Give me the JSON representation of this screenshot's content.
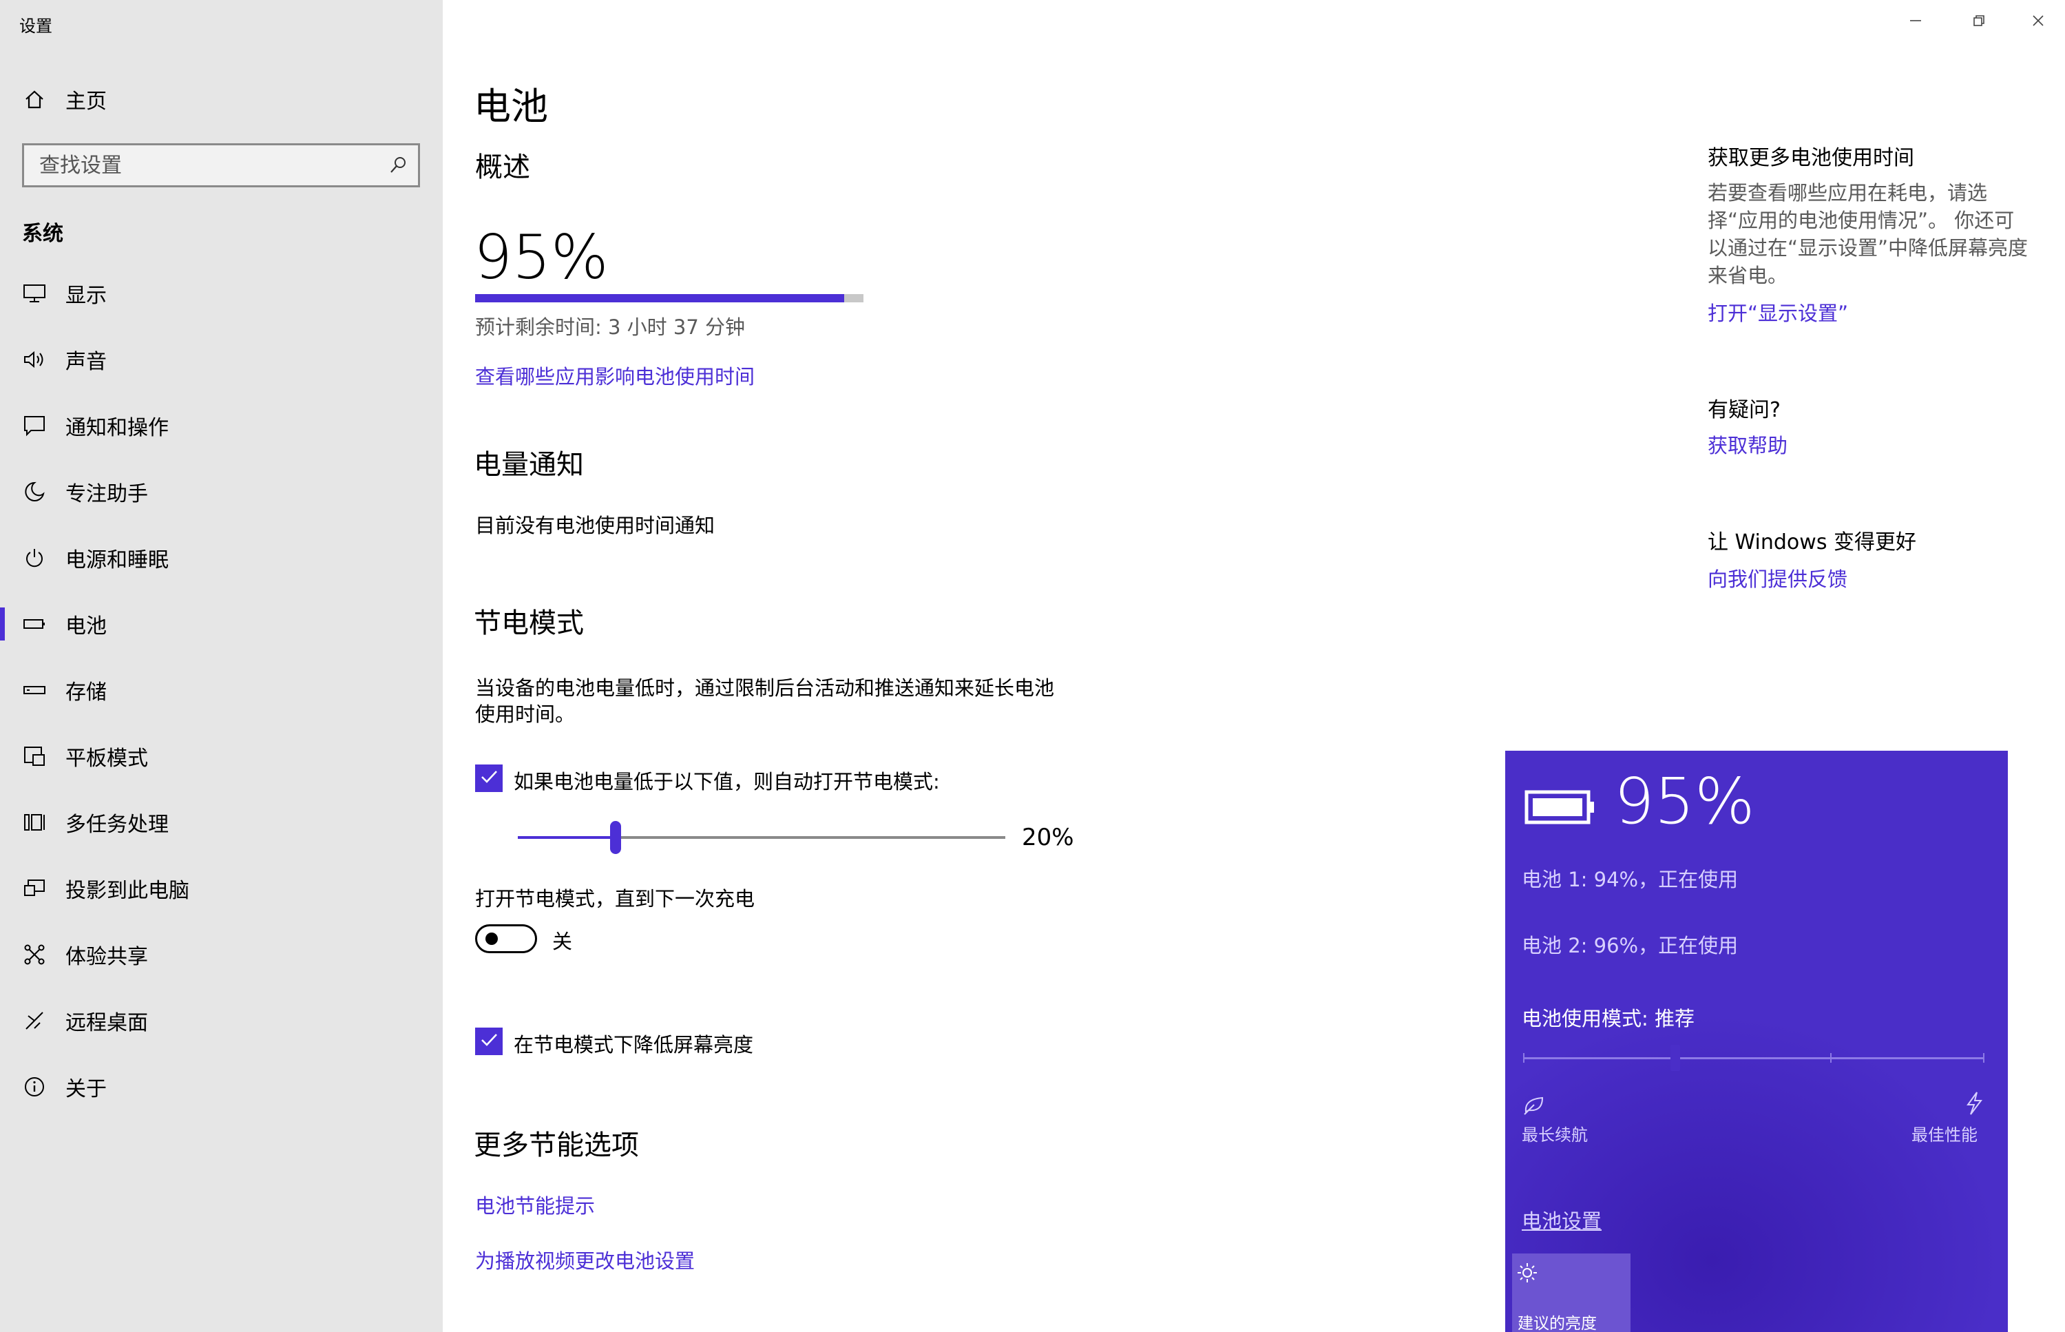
{
  "window": {
    "title": "设置",
    "controls": {
      "minimize": "minimize-icon",
      "restore": "restore-icon",
      "close": "close-icon"
    }
  },
  "sidebar": {
    "home_label": "主页",
    "search_placeholder": "查找设置",
    "section_title": "系统",
    "items": [
      {
        "label": "显示",
        "icon": "monitor-icon"
      },
      {
        "label": "声音",
        "icon": "speaker-icon"
      },
      {
        "label": "通知和操作",
        "icon": "notification-icon"
      },
      {
        "label": "专注助手",
        "icon": "moon-icon"
      },
      {
        "label": "电源和睡眠",
        "icon": "power-icon"
      },
      {
        "label": "电池",
        "icon": "battery-icon",
        "active": true
      },
      {
        "label": "存储",
        "icon": "storage-icon"
      },
      {
        "label": "平板模式",
        "icon": "tablet-icon"
      },
      {
        "label": "多任务处理",
        "icon": "multitask-icon"
      },
      {
        "label": "投影到此电脑",
        "icon": "project-icon"
      },
      {
        "label": "体验共享",
        "icon": "share-icon"
      },
      {
        "label": "远程桌面",
        "icon": "remote-icon"
      },
      {
        "label": "关于",
        "icon": "info-icon"
      }
    ],
    "accent": "#4c2fd6"
  },
  "main": {
    "page_title": "电池",
    "overview": {
      "heading": "概述",
      "percent_text": "95%",
      "percent_value": 0.95,
      "remaining": "预计剩余时间: 3 小时 37 分钟",
      "link": "查看哪些应用影响电池使用时间"
    },
    "notification": {
      "heading": "电量通知",
      "text": "目前没有电池使用时间通知"
    },
    "saver": {
      "heading": "节电模式",
      "description_line1": "当设备的电池电量低时，通过限制后台活动和推送通知来延长电池",
      "description_line2": "使用时间。",
      "auto_checkbox_label": "如果电池电量低于以下值，则自动打开节电模式:",
      "auto_checked": true,
      "threshold_text": "20%",
      "threshold_value": 0.2,
      "toggle_label": "打开节电模式，直到下一次充电",
      "toggle_state": "关",
      "toggle_on": false,
      "dim_checkbox_label": "在节电模式下降低屏幕亮度",
      "dim_checked": true
    },
    "more": {
      "heading": "更多节能选项",
      "links": [
        "电池节能提示",
        "为播放视频更改电池设置"
      ]
    }
  },
  "right_panel": {
    "battery_time": {
      "heading": "获取更多电池使用时间",
      "lines": [
        "若要查看哪些应用在耗电，请选",
        "择“应用的电池使用情况”。 你还可",
        "以通过在“显示设置”中降低屏幕亮度",
        "来省电。"
      ],
      "link": "打开“显示设置”"
    },
    "question": {
      "heading": "有疑问?",
      "link": "获取帮助"
    },
    "feedback": {
      "heading": "让 Windows 变得更好",
      "link": "向我们提供反馈"
    }
  },
  "flyout": {
    "percent_text": "95%",
    "battery1": "电池 1: 94%，正在使用",
    "battery2": "电池 2: 96%，正在使用",
    "mode_label": "电池使用模式: 推荐",
    "mode_value": 0.33,
    "left_label": "最长续航",
    "right_label": "最佳性能",
    "settings_link": "电池设置",
    "tile_label": "建议的亮度",
    "colors": {
      "background": "#4a2ec8",
      "tile": "#6c54d1"
    }
  }
}
